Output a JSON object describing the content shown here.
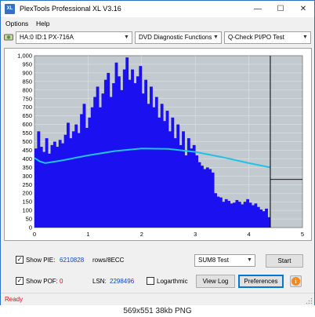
{
  "window": {
    "title": "PlexTools Professional XL V3.16",
    "icon_label": "XL",
    "controls": [
      "—",
      "☐",
      "✕"
    ]
  },
  "menu": [
    "Options",
    "Help"
  ],
  "toolbar": {
    "drive": "HA:0 ID:1  PX-716A",
    "function": "DVD Diagnostic Functions",
    "test": "Q-Check PI/PO Test"
  },
  "chart_data": {
    "type": "bar",
    "title": "",
    "xlabel": "",
    "ylabel": "",
    "xlim": [
      0,
      5
    ],
    "ylim": [
      0,
      1000
    ],
    "x_ticks": [
      "0",
      "1",
      "2",
      "3",
      "4",
      "5"
    ],
    "y_ticks": [
      "0",
      "50",
      "100",
      "150",
      "200",
      "250",
      "300",
      "350",
      "400",
      "450",
      "500",
      "550",
      "600",
      "650",
      "700",
      "750",
      "800",
      "850",
      "900",
      "950",
      "1,000"
    ],
    "grid": true,
    "marker_x": 4.4,
    "marker_y": 280,
    "colors": {
      "bars": "#1a10f0",
      "speed_line": "#1fc3e6",
      "background": "#c2c9cf",
      "marker": "#000000"
    },
    "series": [
      {
        "type": "bar",
        "x": [
          0.0,
          0.05,
          0.1,
          0.15,
          0.2,
          0.25,
          0.3,
          0.35,
          0.4,
          0.45,
          0.5,
          0.55,
          0.6,
          0.65,
          0.7,
          0.75,
          0.8,
          0.85,
          0.9,
          0.95,
          1.0,
          1.05,
          1.1,
          1.15,
          1.2,
          1.25,
          1.3,
          1.35,
          1.4,
          1.45,
          1.5,
          1.55,
          1.6,
          1.65,
          1.7,
          1.75,
          1.8,
          1.85,
          1.9,
          1.95,
          2.0,
          2.05,
          2.1,
          2.15,
          2.2,
          2.25,
          2.3,
          2.35,
          2.4,
          2.45,
          2.5,
          2.55,
          2.6,
          2.65,
          2.7,
          2.75,
          2.8,
          2.85,
          2.9,
          2.95,
          3.0,
          3.05,
          3.1,
          3.15,
          3.2,
          3.25,
          3.3,
          3.35,
          3.4,
          3.45,
          3.5,
          3.55,
          3.6,
          3.65,
          3.7,
          3.75,
          3.8,
          3.85,
          3.9,
          3.95,
          4.0,
          4.05,
          4.1,
          4.15,
          4.2,
          4.25,
          4.3,
          4.35
        ],
        "values": [
          460,
          560,
          470,
          440,
          520,
          430,
          480,
          500,
          470,
          510,
          490,
          540,
          610,
          520,
          560,
          600,
          550,
          660,
          720,
          580,
          640,
          700,
          760,
          820,
          700,
          780,
          860,
          900,
          760,
          840,
          960,
          880,
          800,
          920,
          990,
          860,
          920,
          840,
          880,
          940,
          780,
          860,
          720,
          820,
          700,
          760,
          640,
          720,
          620,
          680,
          560,
          640,
          520,
          600,
          480,
          560,
          420,
          520,
          460,
          480,
          420,
          380,
          360,
          340,
          350,
          340,
          320,
          200,
          180,
          175,
          150,
          165,
          155,
          140,
          145,
          160,
          150,
          135,
          150,
          165,
          145,
          130,
          140,
          120,
          105,
          95,
          110,
          60
        ]
      },
      {
        "type": "line",
        "x": [
          0.0,
          0.1,
          0.2,
          0.5,
          1.0,
          1.5,
          2.0,
          2.5,
          3.0,
          3.5,
          4.0,
          4.4
        ],
        "values": [
          405,
          385,
          375,
          390,
          420,
          445,
          460,
          458,
          440,
          410,
          375,
          350
        ]
      }
    ]
  },
  "stats": {
    "show_pie_label": "Show PIE:",
    "pie_value": "6210828",
    "pie_unit": "rows/8ECC",
    "show_pof_label": "Show POF:",
    "pof_value": "0",
    "lsn_label": "LSN:",
    "lsn_value": "2298496",
    "logarithmic_label": "Logarthmic"
  },
  "controls": {
    "test_mode": "SUM8 Test",
    "start": "Start",
    "view_log": "View Log",
    "preferences": "Preferences",
    "info_glyph": "i"
  },
  "status": {
    "text": "Ready"
  },
  "caption": "569x551 38kb PNG"
}
